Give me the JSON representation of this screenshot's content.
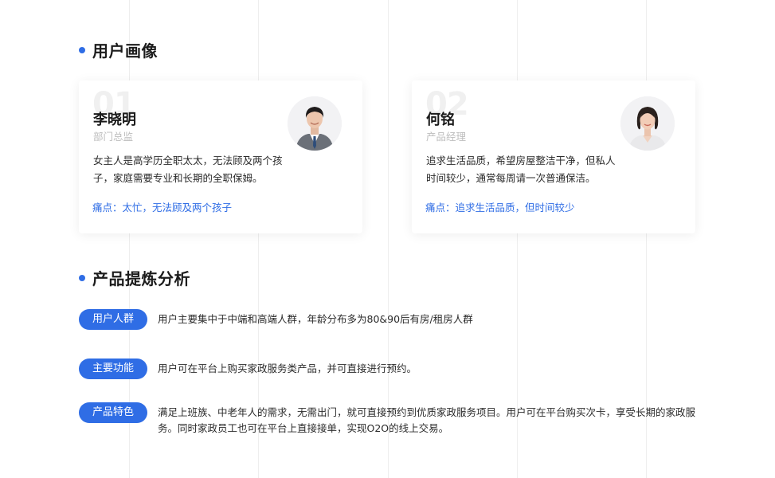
{
  "persona_section": {
    "title": "用户画像"
  },
  "personas": [
    {
      "number": "01",
      "name": "李晓明",
      "role": "部门总监",
      "avatar_icon": "male-avatar",
      "description": "女主人是高学历全职太太，无法顾及两个孩子，家庭需要专业和长期的全职保姆。",
      "pain_point": "痛点：太忙，无法顾及两个孩子"
    },
    {
      "number": "02",
      "name": "何铭",
      "role": "产品经理",
      "avatar_icon": "female-avatar",
      "description": "追求生活品质，希望房屋整洁干净，但私人时间较少，通常每周请一次普通保洁。",
      "pain_point": "痛点：追求生活品质，但时间较少"
    }
  ],
  "analysis_section": {
    "title": "产品提炼分析"
  },
  "analysis": [
    {
      "label": "用户人群",
      "text": "用户主要集中于中端和高端人群，年龄分布多为80&90后有房/租房人群"
    },
    {
      "label": "主要功能",
      "text": "用户可在平台上购买家政服务类产品，并可直接进行预约。"
    },
    {
      "label": "产品特色",
      "text": "满足上班族、中老年人的需求，无需出门，就可直接预约到优质家政服务项目。用户可在平台购买次卡，享受长期的家政服务。同时家政员工也可在平台上直接接单，实现O2O的线上交易。"
    }
  ],
  "colors": {
    "accent": "#2f6de5",
    "watermark": "#f0f0f0"
  }
}
